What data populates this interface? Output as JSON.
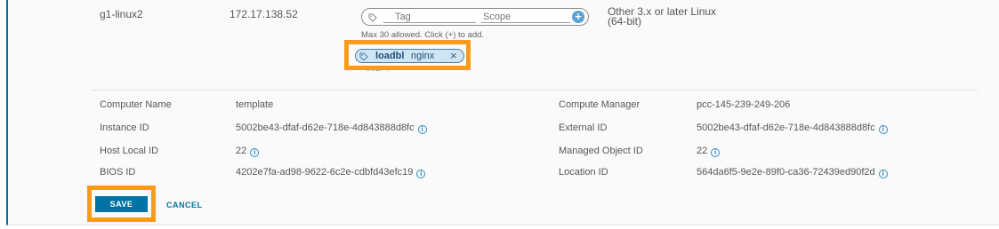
{
  "vm_row": {
    "name": "g1-linux2",
    "ip": "172.17.138.52",
    "os_line1": "Other 3.x or later Linux",
    "os_line2": "(64-bit)"
  },
  "tag_editor": {
    "tag_placeholder": "Tag",
    "scope_placeholder": "Scope",
    "add_symbol": "+",
    "hint": "Max 30 allowed. Click (+) to add.",
    "chip_tag": "loadbl",
    "chip_scope": "nginx",
    "chip_close": "×",
    "total": "Total: 1"
  },
  "details": {
    "left": [
      {
        "label": "Computer Name",
        "value": "template",
        "info": false
      },
      {
        "label": "Instance ID",
        "value": "5002be43-dfaf-d62e-718e-4d843888d8fc",
        "info": true
      },
      {
        "label": "Host Local ID",
        "value": "22",
        "info": true
      },
      {
        "label": "BIOS ID",
        "value": "4202e7fa-ad98-9622-6c2e-cdbfd43efc19",
        "info": true
      }
    ],
    "right": [
      {
        "label": "Compute Manager",
        "value": "pcc-145-239-249-206",
        "info": false
      },
      {
        "label": "External ID",
        "value": "5002be43-dfaf-d62e-718e-4d843888d8fc",
        "info": true
      },
      {
        "label": "Managed Object ID",
        "value": "22",
        "info": true
      },
      {
        "label": "Location ID",
        "value": "564da6f5-9e2e-89f0-ca36-72439ed90f2d",
        "info": true
      }
    ],
    "info_symbol": "i"
  },
  "actions": {
    "save_label": "SAVE",
    "cancel_label": "CANCEL"
  },
  "colors": {
    "accent": "#0072a3",
    "highlight": "#f89a1c",
    "chip_bg": "#cfe5f4"
  }
}
